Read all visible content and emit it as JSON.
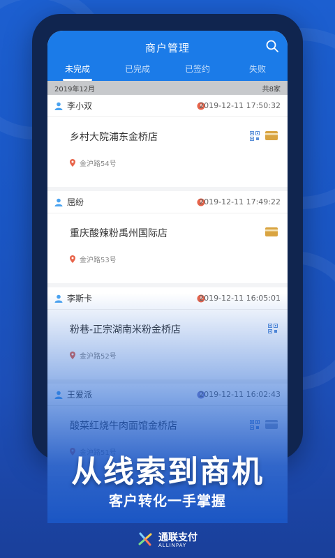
{
  "appbar": {
    "title": "商户管理",
    "tabs": [
      {
        "label": "未完成",
        "active": true
      },
      {
        "label": "已完成",
        "active": false
      },
      {
        "label": "已签约",
        "active": false
      },
      {
        "label": "失败",
        "active": false
      }
    ]
  },
  "section": {
    "month": "2019年12月",
    "count": "共8家"
  },
  "cards": [
    {
      "name": "李小双",
      "time": "2019-12-11 17:50:32",
      "store": "乡村大院浦东金桥店",
      "address": "金沪路54号",
      "qr": true,
      "card": true
    },
    {
      "name": "屈纷",
      "time": "2019-12-11 17:49:22",
      "store": "重庆酸辣粉禹州国际店",
      "address": "金沪路53号",
      "qr": false,
      "card": true
    },
    {
      "name": "李斯卡",
      "time": "2019-12-11 16:05:01",
      "store": "粉巷-正宗湖南米粉金桥店",
      "address": "金沪路52号",
      "qr": true,
      "card": false
    },
    {
      "name": "王爱派",
      "time": "2019-12-11 16:02:43",
      "store": "酸菜红烧牛肉面馆金桥店",
      "address": "金沪路51号",
      "qr": true,
      "card": true
    }
  ],
  "promo": {
    "headline": "从线索到商机",
    "subline": "客户转化一手掌握"
  },
  "brand": {
    "name": "通联支付",
    "sub": "ALLINPAY"
  },
  "colors": {
    "primary": "#1b7be8",
    "background": "#1c5fd0",
    "clock": "#e8644a",
    "qr": "#5a8fd8",
    "card": "#d9a441"
  }
}
